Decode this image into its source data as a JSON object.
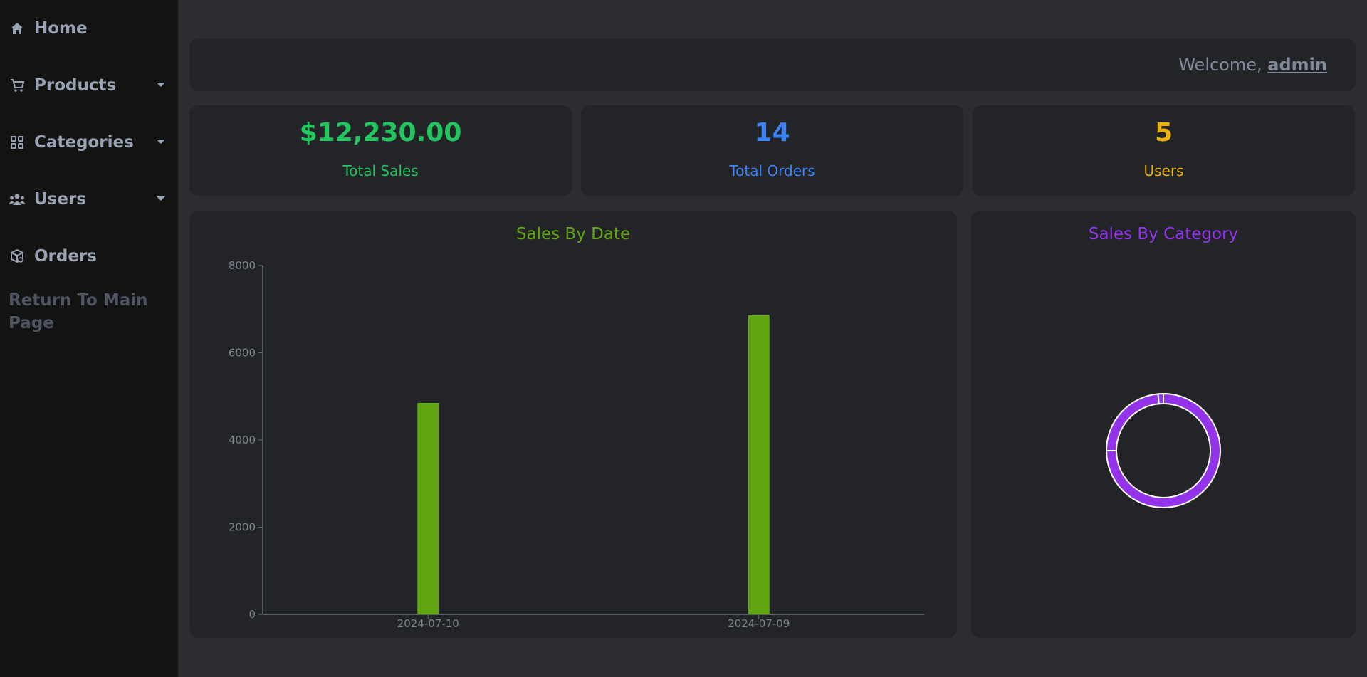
{
  "sidebar": {
    "items": [
      {
        "label": "Home",
        "icon": "home-icon"
      },
      {
        "label": "Products",
        "icon": "cart-icon",
        "has_dropdown": true
      },
      {
        "label": "Categories",
        "icon": "grid-icon",
        "has_dropdown": true
      },
      {
        "label": "Users",
        "icon": "users-icon",
        "has_dropdown": true
      },
      {
        "label": "Orders",
        "icon": "box-icon"
      }
    ],
    "return_link": "Return To Main Page"
  },
  "header": {
    "welcome_prefix": "Welcome,",
    "username": "admin"
  },
  "stats": [
    {
      "value": "$12,230.00",
      "label": "Total Sales",
      "color": "#22c55e"
    },
    {
      "value": "14",
      "label": "Total Orders",
      "color": "#3b82f6"
    },
    {
      "value": "5",
      "label": "Users",
      "color": "#eab308"
    }
  ],
  "colors": {
    "bar": "#62a611",
    "donut": "#9333ea",
    "sales_title": "#62a611",
    "category_title": "#9333ea"
  },
  "chart_data": [
    {
      "type": "bar",
      "title": "Sales By Date",
      "categories": [
        "2024-07-10",
        "2024-07-09"
      ],
      "values": [
        4850,
        6860
      ],
      "ylim": [
        0,
        8000
      ],
      "yticks": [
        0,
        2000,
        4000,
        6000,
        8000
      ],
      "xlabel": "",
      "ylabel": "",
      "grid": false
    },
    {
      "type": "pie",
      "title": "Sales By Category",
      "donut": true,
      "values": [
        75,
        23.5,
        1.5
      ]
    }
  ]
}
